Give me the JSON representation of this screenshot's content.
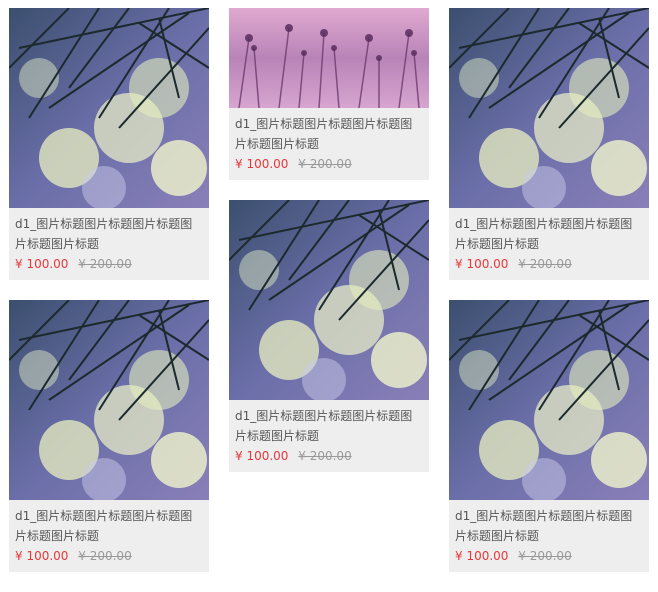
{
  "colors": {
    "price": "#e4393c",
    "old_price": "#999999",
    "card_bg": "#eeeeee"
  },
  "columns": [
    [
      {
        "image": "pine-droplets-bokeh",
        "title": "d1_图片标题图片标题图片标题图片标题图片标题",
        "price": "¥ 100.00",
        "old_price": "¥ 200.00"
      },
      {
        "image": "pine-droplets-bokeh",
        "title": "d1_图片标题图片标题图片标题图片标题图片标题",
        "price": "¥ 100.00",
        "old_price": "¥ 200.00"
      }
    ],
    [
      {
        "image": "purple-field-flowers",
        "title": "d1_图片标题图片标题图片标题图片标题图片标题",
        "price": "¥ 100.00",
        "old_price": "¥ 200.00"
      },
      {
        "image": "pine-droplets-bokeh",
        "title": "d1_图片标题图片标题图片标题图片标题图片标题",
        "price": "¥ 100.00",
        "old_price": "¥ 200.00"
      }
    ],
    [
      {
        "image": "pine-droplets-bokeh",
        "title": "d1_图片标题图片标题图片标题图片标题图片标题",
        "price": "¥ 100.00",
        "old_price": "¥ 200.00"
      },
      {
        "image": "pine-droplets-bokeh",
        "title": "d1_图片标题图片标题图片标题图片标题图片标题",
        "price": "¥ 100.00",
        "old_price": "¥ 200.00"
      }
    ]
  ]
}
